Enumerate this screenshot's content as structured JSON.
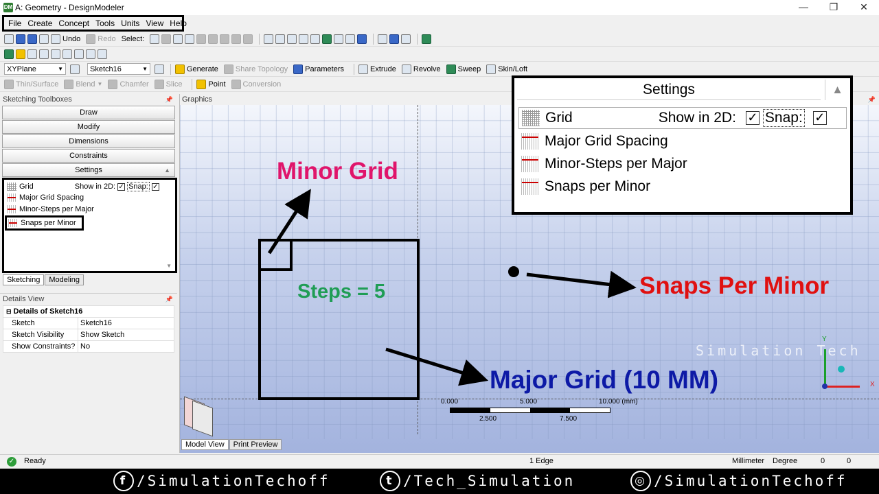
{
  "window": {
    "title": "A: Geometry - DesignModeler",
    "icon_label": "DM",
    "min": "—",
    "max": "❐",
    "close": "✕"
  },
  "menu": [
    "File",
    "Create",
    "Concept",
    "Tools",
    "Units",
    "View",
    "Help"
  ],
  "toolbar1": {
    "undo": "Undo",
    "redo": "Redo",
    "select": "Select:"
  },
  "toolbar3": {
    "plane": "XYPlane",
    "sketch": "Sketch16",
    "generate": "Generate",
    "share_topology": "Share Topology",
    "parameters": "Parameters",
    "extrude": "Extrude",
    "revolve": "Revolve",
    "sweep": "Sweep",
    "skin_loft": "Skin/Loft"
  },
  "toolbar4": {
    "thin_surface": "Thin/Surface",
    "blend": "Blend",
    "chamfer": "Chamfer",
    "slice": "Slice",
    "point": "Point",
    "conversion": "Conversion"
  },
  "sketching_toolboxes": {
    "title": "Sketching Toolboxes",
    "buttons": [
      "Draw",
      "Modify",
      "Dimensions",
      "Constraints",
      "Settings"
    ]
  },
  "settings_small": {
    "grid": "Grid",
    "show_in_2d": "Show in 2D:",
    "snap": "Snap:",
    "items": [
      "Major Grid Spacing",
      "Minor-Steps per Major",
      "Snaps per Minor"
    ]
  },
  "left_tabs": [
    "Sketching",
    "Modeling"
  ],
  "details": {
    "title": "Details View",
    "header": "Details of Sketch16",
    "rows": [
      [
        "Sketch",
        "Sketch16"
      ],
      [
        "Sketch Visibility",
        "Show Sketch"
      ],
      [
        "Show Constraints?",
        "No"
      ]
    ]
  },
  "graphics": {
    "title": "Graphics"
  },
  "zoom_settings": {
    "title": "Settings",
    "grid": "Grid",
    "show_in_2d": "Show in 2D:",
    "snap": "Snap:",
    "items": [
      "Major Grid Spacing",
      "Minor-Steps per Major",
      "Snaps per Minor"
    ]
  },
  "annotations": {
    "minor_grid": "Minor Grid",
    "steps": "Steps = 5",
    "snaps_per_minor": "Snaps Per Minor",
    "major_grid": "Major Grid (10 MM)",
    "watermark": "Simulation Tech"
  },
  "scale": {
    "t0": "0.000",
    "t1": "5.000",
    "t2": "10.000 (mm)",
    "b1": "2.500",
    "b2": "7.500"
  },
  "axes": {
    "y": "Y",
    "x": "X"
  },
  "bottom_tabs": [
    "Model View",
    "Print Preview"
  ],
  "status": {
    "ready": "Ready",
    "selection": "1 Edge",
    "units": "Millimeter",
    "angle": "Degree",
    "v1": "0",
    "v2": "0"
  },
  "social": [
    {
      "icon": "f",
      "handle": "/SimulationTechoff"
    },
    {
      "icon": "t",
      "handle": "/Tech_Simulation"
    },
    {
      "icon": "◎",
      "handle": "/SimulationTechoff"
    }
  ],
  "colors": {
    "magenta": "#e0156b",
    "green": "#1f9d55",
    "red": "#e01010",
    "navy": "#0d1aa6"
  }
}
